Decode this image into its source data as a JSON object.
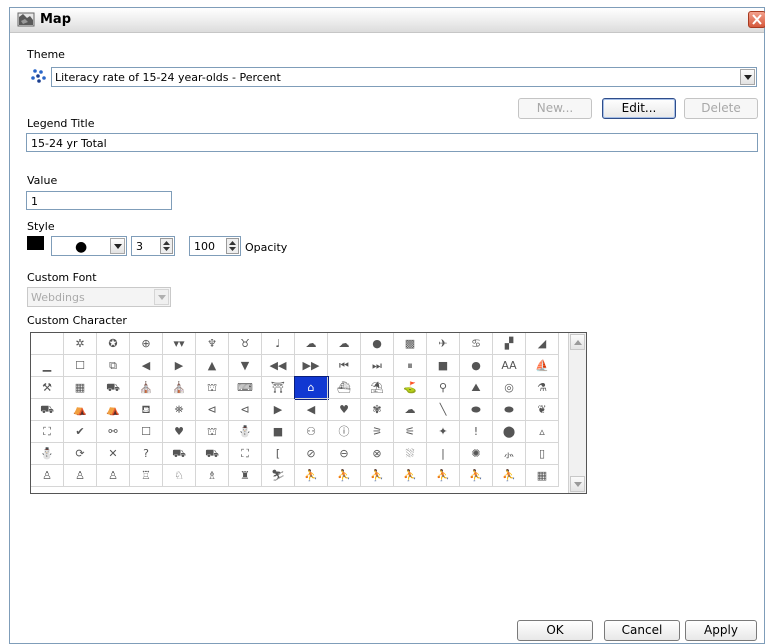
{
  "window": {
    "title": "Map"
  },
  "theme": {
    "label": "Theme",
    "selected": "Literacy rate of 15-24 year-olds - Percent",
    "buttons": {
      "new": "New...",
      "edit": "Edit...",
      "delete": "Delete"
    }
  },
  "legend": {
    "label": "Legend Title",
    "value": "15-24 yr Total"
  },
  "value": {
    "label": "Value",
    "value": "1"
  },
  "style": {
    "label": "Style",
    "color": "#000000",
    "symbol": "●",
    "size": "3",
    "opacity_value": "100",
    "opacity_label": "Opacity"
  },
  "custom_font": {
    "label": "Custom Font",
    "value": "Webdings"
  },
  "custom_character": {
    "label": "Custom Character",
    "rows": [
      [
        "",
        "✲",
        "✪",
        "⊕",
        "▾▾",
        "♆",
        "♉",
        "♩",
        "☁",
        "☁",
        "●",
        "▩",
        "✈",
        "♋",
        "▞",
        "◢"
      ],
      [
        "▁",
        "☐",
        "⧉",
        "◀",
        "▶",
        "▲",
        "▼",
        "◀◀",
        "▶▶",
        "⏮",
        "⏭",
        "⏸",
        "■",
        "●",
        "AA",
        "⛵"
      ],
      [
        "⚒",
        "▦",
        "⛟",
        "⛪",
        "⛪",
        "⛫",
        "⌨",
        "⛩",
        "⌂",
        "⛴",
        "⛱",
        "⛳",
        "⚲",
        "⛰",
        "◎",
        "⚗"
      ],
      [
        "⛟",
        "⛺",
        "⛺",
        "⛾",
        "⛯",
        "⊲",
        "⊲",
        "▶",
        "◀",
        "♥",
        "✾",
        "☁",
        "╲",
        "⬬",
        "⬬",
        "❦"
      ],
      [
        "⛶",
        "✔",
        "⚯",
        "☐",
        "♥",
        "⛫",
        "⛄",
        "■",
        "⚇",
        "ⓘ",
        "⚞",
        "⚟",
        "✦",
        "!",
        "⬤",
        "▵"
      ],
      [
        "⛄",
        "⟳",
        "✕",
        "?",
        "⛟",
        "⛟",
        "⛶",
        "[",
        "⊘",
        "⊖",
        "⊗",
        "⛆",
        "|",
        "✺",
        "⺗",
        "▯"
      ],
      [
        "♙",
        "♙",
        "♙",
        "♖",
        "♘",
        "♗",
        "♜",
        "⛷",
        "⛹",
        "⛹",
        "⛹",
        "⛹",
        "⛹",
        "⛹",
        "⛹",
        "▦"
      ]
    ],
    "selected_cell": "2-8"
  },
  "footer": {
    "ok": "OK",
    "cancel": "Cancel",
    "apply": "Apply"
  }
}
